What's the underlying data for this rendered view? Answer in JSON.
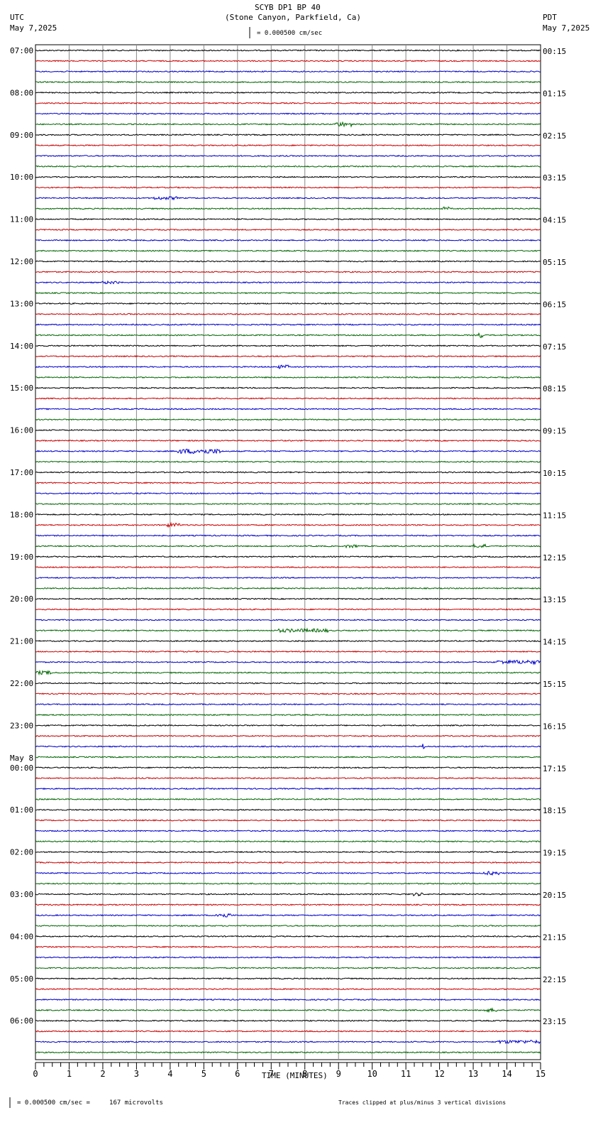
{
  "header": {
    "title": "SCYB DP1 BP 40",
    "subtitle": "(Stone Canyon, Parkfield, Ca)",
    "left_tz": "UTC",
    "left_date": "May 7,2025",
    "right_tz": "PDT",
    "right_date": "May 7,2025",
    "scale": "= 0.000500 cm/sec"
  },
  "footer": {
    "scale": "= 0.000500 cm/sec =     167 microvolts",
    "clip_note": "Traces clipped at plus/minus 3 vertical divisions"
  },
  "chart_data": {
    "type": "line",
    "title": "SCYB DP1 BP 40",
    "xlabel": "TIME (MINUTES)",
    "xlim": [
      0,
      15
    ],
    "x_ticks": [
      "0",
      "1",
      "2",
      "3",
      "4",
      "5",
      "6",
      "7",
      "8",
      "9",
      "10",
      "11",
      "12",
      "13",
      "14",
      "15"
    ],
    "trace_count": 96,
    "trace_minutes": 15,
    "trace_colors": [
      "#000000",
      "#cc0000",
      "#0000cc",
      "#006600"
    ],
    "date_change_label": "May 8",
    "left_labels": [
      "07:00",
      "08:00",
      "09:00",
      "10:00",
      "11:00",
      "12:00",
      "13:00",
      "14:00",
      "15:00",
      "16:00",
      "17:00",
      "18:00",
      "19:00",
      "20:00",
      "21:00",
      "22:00",
      "23:00",
      "00:00",
      "01:00",
      "02:00",
      "03:00",
      "04:00",
      "05:00",
      "06:00"
    ],
    "right_labels": [
      "00:15",
      "01:15",
      "02:15",
      "03:15",
      "04:15",
      "05:15",
      "06:15",
      "07:15",
      "08:15",
      "09:15",
      "10:15",
      "11:15",
      "12:15",
      "13:15",
      "14:15",
      "15:15",
      "16:15",
      "17:15",
      "18:15",
      "19:15",
      "20:15",
      "21:15",
      "22:15",
      "23:15"
    ],
    "events": [
      {
        "trace": 7,
        "start": 8.9,
        "end": 9.4,
        "amp": 2.2
      },
      {
        "trace": 14,
        "start": 3.5,
        "end": 4.2,
        "amp": 1.3
      },
      {
        "trace": 15,
        "start": 12.1,
        "end": 12.3,
        "amp": 1.5
      },
      {
        "trace": 22,
        "start": 2.0,
        "end": 2.5,
        "amp": 1.2
      },
      {
        "trace": 27,
        "start": 13.15,
        "end": 13.3,
        "amp": 3
      },
      {
        "trace": 30,
        "start": 7.2,
        "end": 7.5,
        "amp": 1.6
      },
      {
        "trace": 38,
        "start": 4.2,
        "end": 5.5,
        "amp": 2.4
      },
      {
        "trace": 45,
        "start": 3.9,
        "end": 4.3,
        "amp": 1.8
      },
      {
        "trace": 47,
        "start": 9.2,
        "end": 9.6,
        "amp": 1.4
      },
      {
        "trace": 47,
        "start": 13.0,
        "end": 13.4,
        "amp": 1.6
      },
      {
        "trace": 55,
        "start": 7.2,
        "end": 8.7,
        "amp": 1.5
      },
      {
        "trace": 58,
        "start": 13.7,
        "end": 15,
        "amp": 1.8
      },
      {
        "trace": 59,
        "start": 0,
        "end": 0.5,
        "amp": 1.5
      },
      {
        "trace": 66,
        "start": 11.5,
        "end": 11.55,
        "amp": 3
      },
      {
        "trace": 78,
        "start": 13.3,
        "end": 13.8,
        "amp": 1.6
      },
      {
        "trace": 80,
        "start": 11.2,
        "end": 11.5,
        "amp": 1.3
      },
      {
        "trace": 82,
        "start": 5.3,
        "end": 5.8,
        "amp": 2
      },
      {
        "trace": 91,
        "start": 13.3,
        "end": 13.7,
        "amp": 1.4
      },
      {
        "trace": 94,
        "start": 13.7,
        "end": 15,
        "amp": 1.4
      }
    ]
  }
}
